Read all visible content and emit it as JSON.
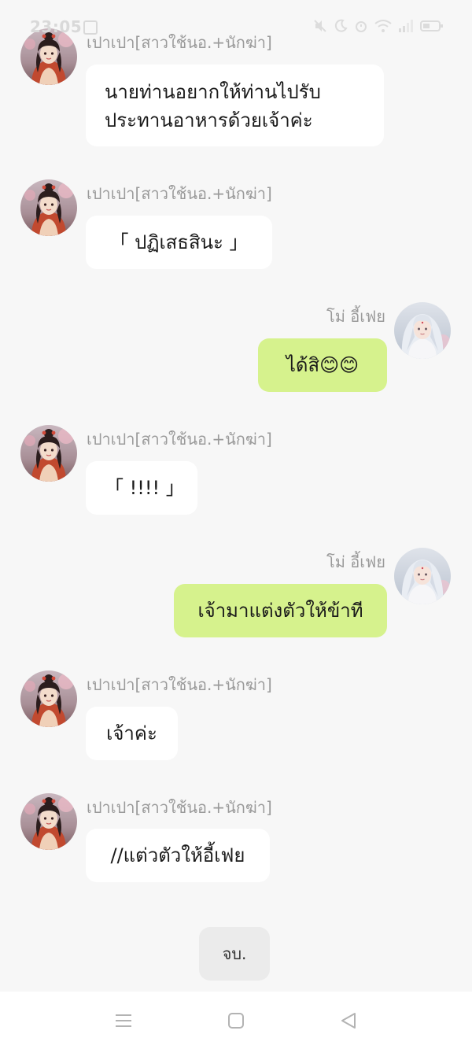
{
  "status_bar": {
    "time": "23:05"
  },
  "messages": [
    {
      "side": "left",
      "sender": "เปาเปา[สาวใช้นอ.+นักฆ่า]",
      "text": "นายท่านอยากให้ท่านไปรับ\nประทานอาหารด้วยเจ้าค่ะ"
    },
    {
      "side": "left",
      "sender": "เปาเปา[สาวใช้นอ.+นักฆ่า]",
      "text": "「 ปฏิเสธสินะ 」"
    },
    {
      "side": "right",
      "sender": "โม่ อี้เฟย",
      "text": "ได้สิ😊😊"
    },
    {
      "side": "left",
      "sender": "เปาเปา[สาวใช้นอ.+นักฆ่า]",
      "text": "「 !!!! 」"
    },
    {
      "side": "right",
      "sender": "โม่ อี้เฟย",
      "text": "เจ้ามาแต่งตัวให้ข้าที"
    },
    {
      "side": "left",
      "sender": "เปาเปา[สาวใช้นอ.+นักฆ่า]",
      "text": "เจ้าค่ะ"
    },
    {
      "side": "left",
      "sender": "เปาเปา[สาวใช้นอ.+นักฆ่า]",
      "text": "//แต่วตัวให้อี้เฟย"
    }
  ],
  "end_button": {
    "label": "จบ."
  },
  "nav_bar": {
    "items": [
      "menu-icon",
      "home-square-icon",
      "back-triangle-icon"
    ]
  },
  "colors": {
    "background": "#f7f7f7",
    "bubble_left": "#ffffff",
    "bubble_right": "#d6f28d",
    "name_text": "#9a9a9a"
  }
}
